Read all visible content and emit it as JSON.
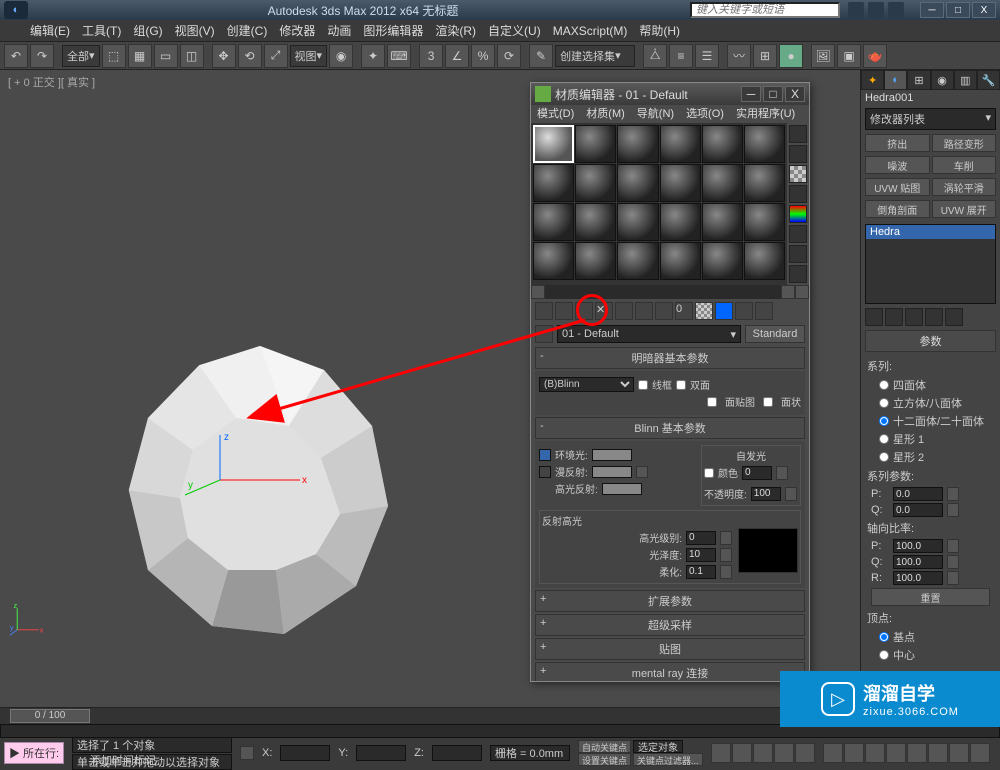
{
  "titlebar": {
    "title": "Autodesk 3ds Max 2012 x64   无标题",
    "search_placeholder": "键入关键字或短语"
  },
  "winbtns": {
    "min": "─",
    "max": "□",
    "close": "X"
  },
  "menubar": [
    "编辑(E)",
    "工具(T)",
    "组(G)",
    "视图(V)",
    "创建(C)",
    "修改器",
    "动画",
    "图形编辑器",
    "渲染(R)",
    "自定义(U)",
    "MAXScript(M)",
    "帮助(H)"
  ],
  "toolbar": {
    "all": "全部",
    "view": "视图",
    "createset": "创建选择集"
  },
  "viewport_label": "[ + 0 正交 ][ 真实 ]",
  "mat_editor": {
    "title": "材质编辑器 - 01 - Default",
    "menu": [
      "模式(D)",
      "材质(M)",
      "导航(N)",
      "选项(O)",
      "实用程序(U)"
    ],
    "name": "01 - Default",
    "type_btn": "Standard",
    "r1": "明暗器基本参数",
    "shader": "(B)Blinn",
    "wire": "线框",
    "twoside": "双面",
    "facemap": "面贴图",
    "faceted": "面状",
    "r2": "Blinn 基本参数",
    "ambient": "环境光:",
    "diffuse": "漫反射:",
    "specular": "高光反射:",
    "selfillum": "自发光",
    "color_cb": "颜色",
    "color_val": "0",
    "opacity": "不透明度:",
    "opacity_val": "100",
    "spec_hl": "反射高光",
    "spec_level": "高光级别:",
    "spec_level_val": "0",
    "gloss": "光泽度:",
    "gloss_val": "10",
    "soften": "柔化:",
    "soften_val": "0.1",
    "r3": "扩展参数",
    "r4": "超级采样",
    "r5": "贴图",
    "r6": "mental ray 连接"
  },
  "cmd_panel": {
    "obj_name": "Hedra001",
    "mod_list_label": "修改器列表",
    "btns": [
      [
        "挤出",
        "路径变形"
      ],
      [
        "噪波",
        "车削"
      ],
      [
        "UVW 贴图",
        "涡轮平滑"
      ],
      [
        "倒角剖面",
        "UVW 展开"
      ]
    ],
    "stack_item": "Hedra",
    "r_params": "参数",
    "family": "系列:",
    "fam_opts": [
      "四面体",
      "立方体/八面体",
      "十二面体/二十面体",
      "星形 1",
      "星形 2"
    ],
    "fam_params": "系列参数:",
    "p_label": "P:",
    "p_val": "0.0",
    "q_label": "Q:",
    "q_val": "0.0",
    "axis_ratio": "轴向比率:",
    "ap": "100.0",
    "aq": "100.0",
    "ar": "100.0",
    "reset": "重置",
    "vertices": "顶点:",
    "vert_opts": [
      "基点",
      "中心"
    ]
  },
  "timeline": {
    "pos": "0 / 100"
  },
  "status": {
    "pink": "▶ 所在行:",
    "sel": "选择了 1 个对象",
    "hint": "单击或单击并拖动以选择对象",
    "x": "X:",
    "y": "Y:",
    "z": "Z:",
    "grid": "栅格 = 0.0mm",
    "add_time": "添加时间标记",
    "autokey": "自动关键点",
    "selset": "选定对象",
    "setkey": "设置关键点",
    "keyfilter": "关键点过滤器..."
  },
  "watermark": {
    "big": "溜溜自学",
    "small": "zixue.3066.COM"
  }
}
